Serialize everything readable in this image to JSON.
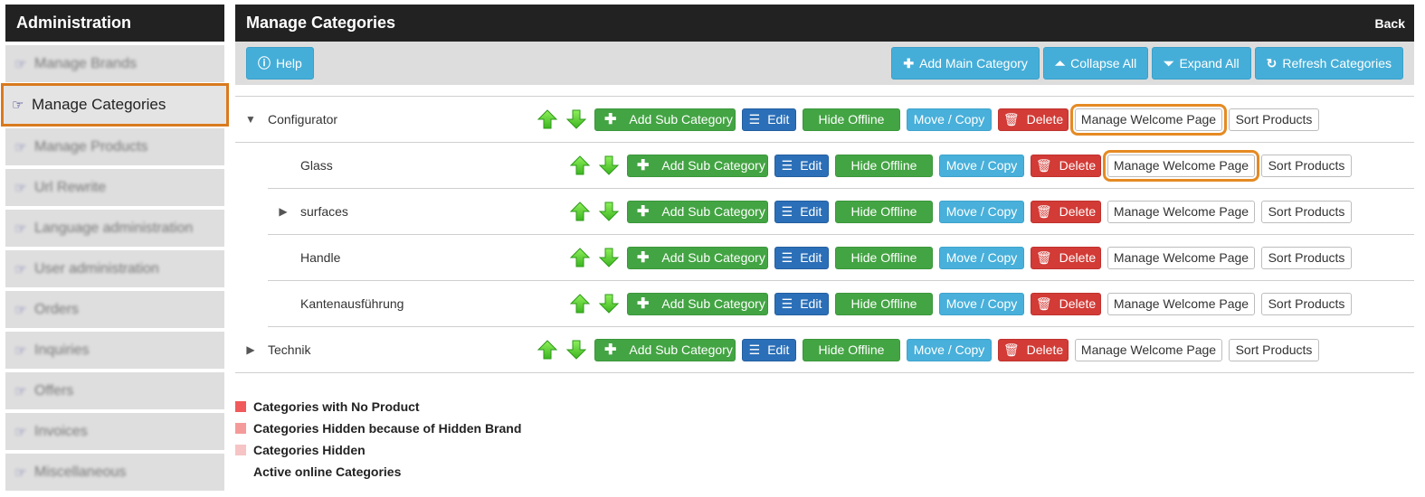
{
  "sidebar": {
    "title": "Administration",
    "items": [
      {
        "label": "Manage Brands",
        "active": false
      },
      {
        "label": "Manage Categories",
        "active": true
      },
      {
        "label": "Manage Products",
        "active": false
      },
      {
        "label": "Url Rewrite",
        "active": false
      },
      {
        "label": "Language administration",
        "active": false
      },
      {
        "label": "User administration",
        "active": false
      },
      {
        "label": "Orders",
        "active": false
      },
      {
        "label": "Inquiries",
        "active": false
      },
      {
        "label": "Offers",
        "active": false
      },
      {
        "label": "Invoices",
        "active": false
      },
      {
        "label": "Miscellaneous",
        "active": false
      }
    ],
    "item_icon": "hand-pointer-icon"
  },
  "header": {
    "title": "Manage Categories",
    "back_label": "Back"
  },
  "toolbar": {
    "help_label": "Help",
    "add_main_label": "Add Main Category",
    "collapse_all_label": "Collapse All",
    "expand_all_label": "Expand All",
    "refresh_label": "Refresh Categories"
  },
  "row_actions": {
    "add_sub": "Add Sub Category",
    "edit": "Edit",
    "hide_offline": "Hide Offline",
    "move_copy": "Move / Copy",
    "delete": "Delete",
    "manage_welcome": "Manage Welcome Page",
    "sort_products": "Sort Products"
  },
  "categories": [
    {
      "name": "Configurator",
      "level": 0,
      "toggle": "expanded"
    },
    {
      "name": "Glass",
      "level": 1,
      "toggle": "none"
    },
    {
      "name": "surfaces",
      "level": 1,
      "toggle": "collapsed"
    },
    {
      "name": "Handle",
      "level": 1,
      "toggle": "none"
    },
    {
      "name": "Kantenausführung",
      "level": 1,
      "toggle": "none"
    },
    {
      "name": "Technik",
      "level": 0,
      "toggle": "collapsed"
    }
  ],
  "legend": [
    {
      "label": "Categories with No Product",
      "color": "#f05a5a"
    },
    {
      "label": "Categories Hidden because of Hidden Brand",
      "color": "#f59a9a"
    },
    {
      "label": "Categories Hidden",
      "color": "#f6c4c4"
    },
    {
      "label": "Active online Categories",
      "color": "#ffffff"
    }
  ],
  "colors": {
    "header_bg": "#222222",
    "highlight_outline": "#e58a23",
    "btn_green": "#43a443",
    "btn_blue": "#2b6fb8",
    "btn_info": "#48b0da",
    "btn_red": "#d23b36"
  }
}
